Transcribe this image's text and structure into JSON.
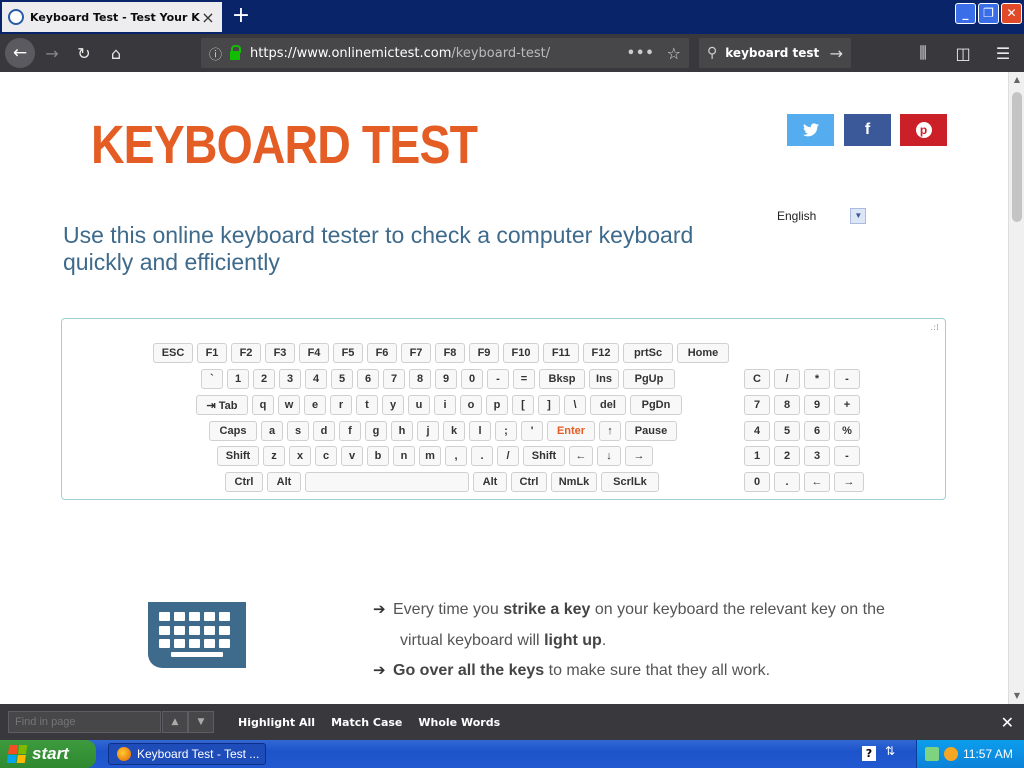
{
  "browser": {
    "tab_title": "Keyboard Test - Test Your Keyboar",
    "new_tab": "+",
    "url_host": "https://www.onlinemictest.com",
    "url_path": "/keyboard-test/",
    "search_value": "keyboard test",
    "window_controls": [
      "minimize",
      "restore",
      "close"
    ]
  },
  "page": {
    "logo": "KEYBOARD TEST",
    "social": {
      "twitter": "t",
      "facebook": "f",
      "pinterest": "p"
    },
    "language": "English",
    "headline": "Use this online keyboard tester to check a computer keyboard quickly and efficiently",
    "keyboard": {
      "row1": [
        "ESC",
        "F1",
        "F2",
        "F3",
        "F4",
        "F5",
        "F6",
        "F7",
        "F8",
        "F9",
        "F10",
        "F11",
        "F12",
        "prtSc",
        "Home"
      ],
      "row2": [
        "`",
        "1",
        "2",
        "3",
        "4",
        "5",
        "6",
        "7",
        "8",
        "9",
        "0",
        "-",
        "=",
        "Bksp",
        "Ins",
        "PgUp"
      ],
      "row3": [
        "⇥ Tab",
        "q",
        "w",
        "e",
        "r",
        "t",
        "y",
        "u",
        "i",
        "o",
        "p",
        "[",
        "]",
        "\\",
        "del",
        "PgDn"
      ],
      "row4": [
        "Caps",
        "a",
        "s",
        "d",
        "f",
        "g",
        "h",
        "j",
        "k",
        "l",
        ";",
        "'",
        "Enter",
        "↑",
        "Pause"
      ],
      "row5": [
        "Shift",
        "z",
        "x",
        "c",
        "v",
        "b",
        "n",
        "m",
        ",",
        ".",
        "/",
        "Shift",
        "←",
        "↓",
        "→"
      ],
      "row6": [
        "Ctrl",
        "Alt",
        "",
        "Alt",
        "Ctrl",
        "NmLk",
        "ScrlLk"
      ],
      "numpad_row1": [
        "C",
        "/",
        "*",
        "-"
      ],
      "numpad_row2": [
        "7",
        "8",
        "9",
        "+"
      ],
      "numpad_row3": [
        "4",
        "5",
        "6",
        "%"
      ],
      "numpad_row4": [
        "1",
        "2",
        "3",
        "-"
      ],
      "numpad_row5": [
        "0",
        ".",
        "←",
        "→"
      ],
      "highlighted_key": "Enter"
    },
    "info": {
      "line1_a": "Every time you ",
      "line1_b": "strike a key",
      "line1_c": " on your keyboard the relevant key on the",
      "line1d_a": "virtual keyboard will ",
      "line1d_b": "light up",
      "line1d_c": ".",
      "line2_b": "Go over all the keys",
      "line2_c": " to make sure that they all work."
    }
  },
  "findbar": {
    "placeholder": "Find in page",
    "highlight_all": "Highlight All",
    "match_case": "Match Case",
    "whole_words": "Whole Words"
  },
  "taskbar": {
    "start": "start",
    "task_label": "Keyboard Test - Test ...",
    "clock": "11:57 AM"
  },
  "colors": {
    "accent_orange": "#e35d24",
    "heading_blue": "#3e6a8c",
    "twitter": "#55acee",
    "facebook": "#3b5998",
    "pinterest": "#cb2027"
  }
}
